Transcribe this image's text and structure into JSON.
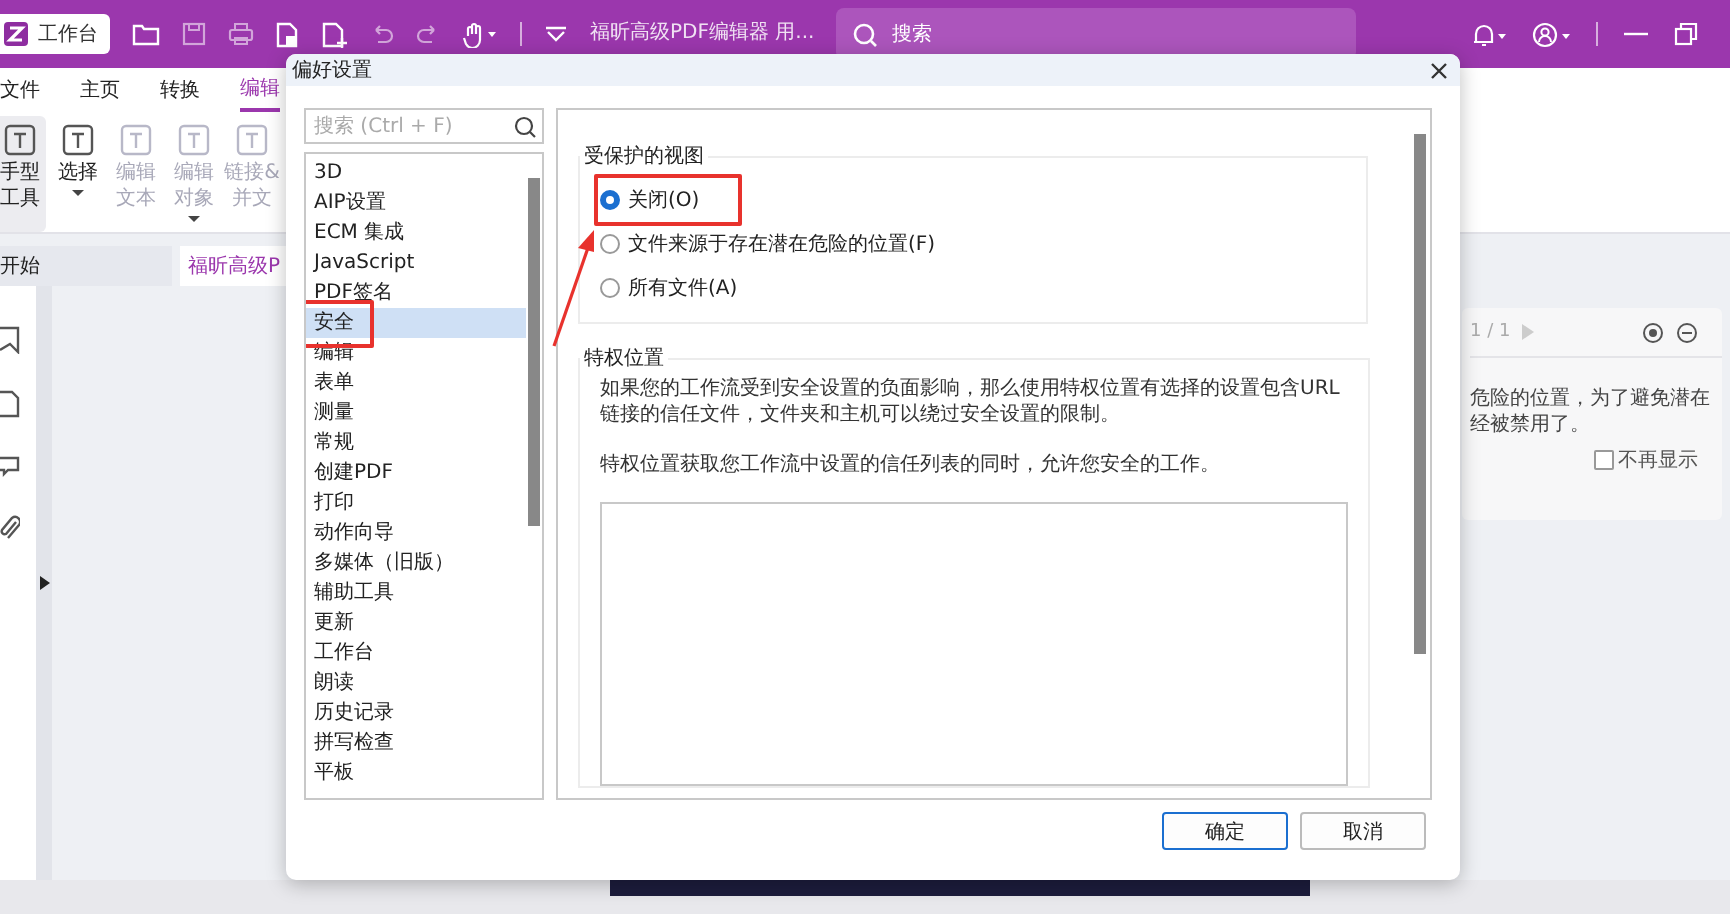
{
  "app_bar": {
    "home_button": "工作台",
    "document_title": "福昕高级PDF编辑器 用...",
    "search": {
      "placeholder": "搜索"
    }
  },
  "ribbon_tabs": [
    {
      "label": "文件",
      "selected": false
    },
    {
      "label": "主页",
      "selected": false
    },
    {
      "label": "转换",
      "selected": false
    },
    {
      "label": "编辑",
      "selected": true
    }
  ],
  "ribbon_tools": [
    {
      "lines": [
        "手型",
        "工具"
      ],
      "selected": true,
      "disabled": false,
      "dropdown": false
    },
    {
      "lines": [
        "选择"
      ],
      "selected": false,
      "disabled": false,
      "dropdown": true
    },
    {
      "lines": [
        "编辑",
        "文本"
      ],
      "selected": false,
      "disabled": true,
      "dropdown": false
    },
    {
      "lines": [
        "编辑",
        "对象"
      ],
      "selected": false,
      "disabled": true,
      "dropdown": true
    },
    {
      "lines": [
        "链接&",
        "并文"
      ],
      "selected": false,
      "disabled": true,
      "dropdown": false
    }
  ],
  "doc_tabs": [
    {
      "label": "开始",
      "selected": false
    },
    {
      "label": "福昕高级P",
      "selected": true
    }
  ],
  "notification": {
    "page": "1 / 1",
    "message_lines": [
      "危险的位置，为了避免潜在",
      "经被禁用了。"
    ],
    "dont_show": {
      "label": "不再显示",
      "checked": false
    }
  },
  "dialog": {
    "title": "偏好设置",
    "search": {
      "placeholder": "搜索 (Ctrl + F)"
    },
    "categories": [
      {
        "label": "3D",
        "selected": false,
        "highlighted": false
      },
      {
        "label": "AIP设置",
        "selected": false,
        "highlighted": false
      },
      {
        "label": "ECM 集成",
        "selected": false,
        "highlighted": false
      },
      {
        "label": "JavaScript",
        "selected": false,
        "highlighted": false
      },
      {
        "label": "PDF签名",
        "selected": false,
        "highlighted": false
      },
      {
        "label": "安全",
        "selected": true,
        "highlighted": true
      },
      {
        "label": "编辑",
        "selected": false,
        "highlighted": false
      },
      {
        "label": "表单",
        "selected": false,
        "highlighted": false
      },
      {
        "label": "测量",
        "selected": false,
        "highlighted": false
      },
      {
        "label": "常规",
        "selected": false,
        "highlighted": false
      },
      {
        "label": "创建PDF",
        "selected": false,
        "highlighted": false
      },
      {
        "label": "打印",
        "selected": false,
        "highlighted": false
      },
      {
        "label": "动作向导",
        "selected": false,
        "highlighted": false
      },
      {
        "label": "多媒体（旧版）",
        "selected": false,
        "highlighted": false
      },
      {
        "label": "辅助工具",
        "selected": false,
        "highlighted": false
      },
      {
        "label": "更新",
        "selected": false,
        "highlighted": false
      },
      {
        "label": "工作台",
        "selected": false,
        "highlighted": false
      },
      {
        "label": "朗读",
        "selected": false,
        "highlighted": false
      },
      {
        "label": "历史记录",
        "selected": false,
        "highlighted": false
      },
      {
        "label": "拼写检查",
        "selected": false,
        "highlighted": false
      },
      {
        "label": "平板",
        "selected": false,
        "highlighted": false
      }
    ],
    "protected_view": {
      "title": "受保护的视图",
      "options": [
        {
          "label": "关闭(O)",
          "selected": true,
          "highlighted": true
        },
        {
          "label": "文件来源于存在潜在危险的位置(F)",
          "selected": false,
          "highlighted": false
        },
        {
          "label": "所有文件(A)",
          "selected": false,
          "highlighted": false
        }
      ]
    },
    "privileged_locations": {
      "title": "特权位置",
      "paragraphs": [
        "如果您的工作流受到安全设置的负面影响，那么使用特权位置有选择的设置包含URL链接的信任文件，文件夹和主机可以绕过安全设置的限制。",
        "特权位置获取您工作流中设置的信任列表的同时，允许您安全的工作。"
      ]
    },
    "buttons": [
      {
        "label": "确定",
        "primary": true
      },
      {
        "label": "取消",
        "primary": false
      }
    ]
  }
}
